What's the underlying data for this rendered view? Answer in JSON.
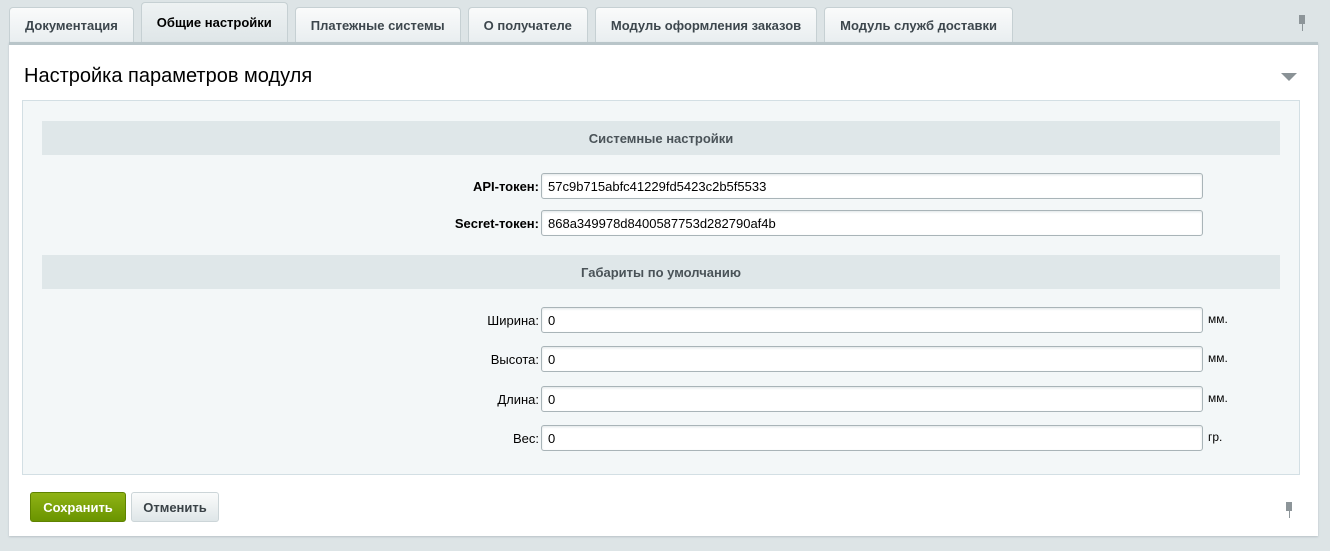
{
  "tabs": [
    "Документация",
    "Общие настройки",
    "Платежные системы",
    "О получателе",
    "Модуль оформления заказов",
    "Модуль служб доставки"
  ],
  "active_tab": 1,
  "title": "Настройка параметров модуля",
  "sections": {
    "system": "Системные настройки",
    "dimensions": "Габариты по умолчанию"
  },
  "fields": {
    "api": {
      "label": "API-токен:",
      "value": "57c9b715abfc41229fd5423c2b5f5533"
    },
    "secret": {
      "label": "Secret-токен:",
      "value": "868a349978d8400587753d282790af4b"
    },
    "width": {
      "label": "Ширина:",
      "value": "0",
      "unit": "мм."
    },
    "height": {
      "label": "Высота:",
      "value": "0",
      "unit": "мм."
    },
    "length": {
      "label": "Длина:",
      "value": "0",
      "unit": "мм."
    },
    "weight": {
      "label": "Вес:",
      "value": "0",
      "unit": "гр."
    }
  },
  "buttons": {
    "save": "Сохранить",
    "cancel": "Отменить"
  },
  "colors": {
    "save": "#7aa20a",
    "page_bg": "#dde4e6"
  }
}
